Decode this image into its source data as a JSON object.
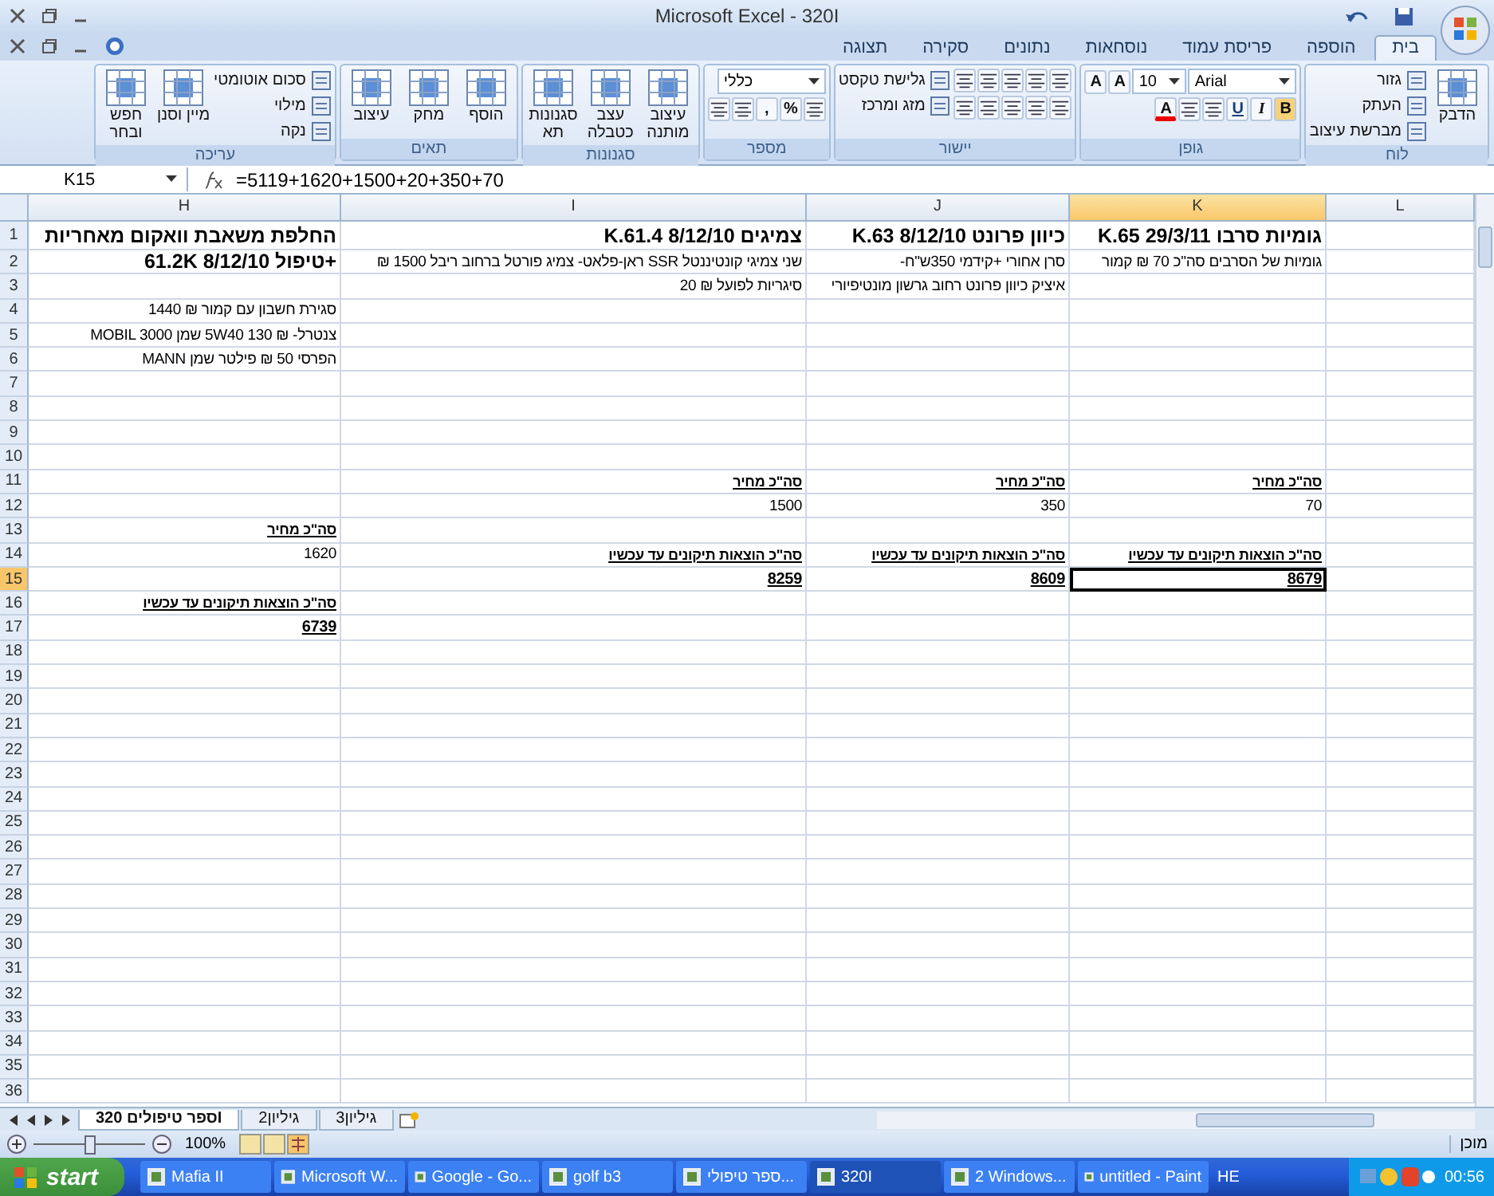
{
  "window": {
    "title": "Microsoft Excel - 320I"
  },
  "ribbon": {
    "tabs": [
      {
        "label": "בית",
        "selected": true
      },
      {
        "label": "הוספה",
        "selected": false
      },
      {
        "label": "פריסת עמוד",
        "selected": false
      },
      {
        "label": "נוסחאות",
        "selected": false
      },
      {
        "label": "נתונים",
        "selected": false
      },
      {
        "label": "סקירה",
        "selected": false
      },
      {
        "label": "תצוגה",
        "selected": false
      }
    ],
    "groups": [
      {
        "label": "לוח",
        "stacks": [
          [
            [
              {
                "kind": "large",
                "label": "הדבק"
              }
            ]
          ],
          [
            [
              {
                "kind": "small",
                "label": "גזור"
              }
            ],
            [
              {
                "kind": "small",
                "label": "העתק"
              }
            ],
            [
              {
                "kind": "small",
                "label": "מברשת עיצוב"
              }
            ]
          ]
        ]
      },
      {
        "label": "גופן",
        "stacks": [
          [
            [
              {
                "kind": "field",
                "value": "Arial"
              },
              {
                "kind": "field",
                "value": "10"
              },
              {
                "kind": "glyph",
                "label": "A"
              },
              {
                "kind": "glyph",
                "label": "A"
              }
            ],
            [
              {
                "kind": "bold",
                "label": "B"
              },
              {
                "kind": "italic",
                "label": "I"
              },
              {
                "kind": "underline",
                "label": "U"
              },
              {
                "kind": "icon"
              },
              {
                "kind": "icon"
              },
              {
                "kind": "colored",
                "label": "A"
              }
            ]
          ]
        ]
      },
      {
        "label": "יישור",
        "stacks": [
          [
            [
              {
                "kind": "icon"
              },
              {
                "kind": "icon"
              },
              {
                "kind": "icon"
              },
              {
                "kind": "icon"
              },
              {
                "kind": "icon"
              }
            ],
            [
              {
                "kind": "icon"
              },
              {
                "kind": "icon"
              },
              {
                "kind": "icon"
              },
              {
                "kind": "icon"
              },
              {
                "kind": "icon"
              }
            ]
          ],
          [
            [
              {
                "kind": "small",
                "label": "גלישת טקסט"
              }
            ],
            [
              {
                "kind": "small",
                "label": "מזג ומרכז"
              }
            ]
          ]
        ]
      },
      {
        "label": "מספר",
        "stacks": [
          [
            [
              {
                "kind": "field",
                "value": "כללי"
              }
            ],
            [
              {
                "kind": "icon"
              },
              {
                "kind": "glyph",
                "label": "%"
              },
              {
                "kind": "glyph",
                "label": ","
              },
              {
                "kind": "icon"
              },
              {
                "kind": "icon"
              }
            ]
          ]
        ]
      },
      {
        "label": "סגנונות",
        "stacks": [
          [
            [
              {
                "kind": "large",
                "label": "עיצוב מותנה"
              }
            ]
          ],
          [
            [
              {
                "kind": "large",
                "label": "עצב כטבלה"
              }
            ]
          ],
          [
            [
              {
                "kind": "large",
                "label": "סגנונות תא"
              }
            ]
          ]
        ]
      },
      {
        "label": "תאים",
        "stacks": [
          [
            [
              {
                "kind": "large",
                "label": "הוסף"
              }
            ]
          ],
          [
            [
              {
                "kind": "large",
                "label": "מחק"
              }
            ]
          ],
          [
            [
              {
                "kind": "large",
                "label": "עיצוב"
              }
            ]
          ]
        ]
      },
      {
        "label": "עריכה",
        "stacks": [
          [
            [
              {
                "kind": "small",
                "label": "סכום אוטומטי"
              }
            ],
            [
              {
                "kind": "small",
                "label": "מילוי"
              }
            ],
            [
              {
                "kind": "small",
                "label": "נקה"
              }
            ]
          ],
          [
            [
              {
                "kind": "large",
                "label": "מיין וסנן"
              }
            ]
          ],
          [
            [
              {
                "kind": "large",
                "label": "חפש ובחר"
              }
            ]
          ]
        ]
      }
    ]
  },
  "formula_bar": {
    "name_box": "K15",
    "formula": "=5119+1620+1500+20+350+70"
  },
  "sheet": {
    "columns": [
      {
        "label": "L",
        "selected": false
      },
      {
        "label": "K",
        "selected": true
      },
      {
        "label": "J",
        "selected": false
      },
      {
        "label": "I",
        "selected": false
      },
      {
        "label": "H",
        "selected": false
      }
    ],
    "rows": [
      {
        "number": "1",
        "selected": false,
        "cells": [
          null,
          {
            "text": "גומיות סרבו K.65 29/3/11",
            "kind": "title",
            "selected": false
          },
          {
            "text": "כיוון פרונט K.63 8/12/10",
            "kind": "title",
            "selected": false
          },
          {
            "text": "צמיגים K.61.4 8/12/10",
            "kind": "title",
            "selected": false
          },
          {
            "text": "החלפת משאבת וואקום מאחריות",
            "kind": "title",
            "selected": false
          }
        ]
      },
      {
        "number": "2",
        "selected": false,
        "cells": [
          null,
          {
            "text": "גומיות של הסרבים סה\"כ 70 ₪ קמור",
            "kind": "text",
            "selected": false
          },
          {
            "text": "סרן אחורי +קידמי 350ש\"ח-",
            "kind": "text",
            "selected": false
          },
          {
            "text": "שני צמיגי קונטיננטל SSR ראן-פלאט- צמיג פורטל ברחוב ריבל 1500 ₪",
            "kind": "text",
            "selected": false
          },
          {
            "text": "+טיפול 61.2K 8/12/10",
            "kind": "title",
            "selected": false
          }
        ]
      },
      {
        "number": "3",
        "selected": false,
        "cells": [
          null,
          null,
          {
            "text": "איציק כיוון פרונט רחוב גרשון מונטיפיורי",
            "kind": "text",
            "selected": false
          },
          {
            "text": "סיגריות לפועל ₪ 20",
            "kind": "text",
            "selected": false
          },
          null
        ]
      },
      {
        "number": "4",
        "selected": false,
        "cells": [
          null,
          null,
          null,
          null,
          {
            "text": "סגירת חשבון עם קמור ₪ 1440",
            "kind": "text",
            "selected": false
          }
        ]
      },
      {
        "number": "5",
        "selected": false,
        "cells": [
          null,
          null,
          null,
          null,
          {
            "text": "צנטרל- ₪ 130 5W40 שמן MOBIL 3000",
            "kind": "text",
            "selected": false
          }
        ]
      },
      {
        "number": "6",
        "selected": false,
        "cells": [
          null,
          null,
          null,
          null,
          {
            "text": "הפרסי 50 ₪ פילטר  שמן MANN",
            "kind": "text",
            "selected": false
          }
        ]
      },
      {
        "number": "7",
        "selected": false
      },
      {
        "number": "8",
        "selected": false
      },
      {
        "number": "9",
        "selected": false
      },
      {
        "number": "10",
        "selected": false
      },
      {
        "number": "11",
        "selected": false,
        "cells": [
          null,
          {
            "text": "סה\"כ מחיר",
            "kind": "label",
            "selected": false
          },
          {
            "text": "סה\"כ מחיר",
            "kind": "label",
            "selected": false
          },
          {
            "text": "סה\"כ מחיר",
            "kind": "label",
            "selected": false
          },
          null
        ]
      },
      {
        "number": "12",
        "selected": false,
        "cells": [
          null,
          {
            "text": "70",
            "kind": "text",
            "selected": false
          },
          {
            "text": "350",
            "kind": "text",
            "selected": false
          },
          {
            "text": "1500",
            "kind": "text",
            "selected": false
          },
          null
        ]
      },
      {
        "number": "13",
        "selected": false,
        "cells": [
          null,
          null,
          null,
          null,
          {
            "text": "סה\"כ מחיר",
            "kind": "label",
            "selected": false
          }
        ]
      },
      {
        "number": "14",
        "selected": false,
        "cells": [
          null,
          {
            "text": "סה\"כ הוצאות תיקונים עד עכשיו",
            "kind": "label",
            "selected": false
          },
          {
            "text": "סה\"כ הוצאות תיקונים עד עכשיו",
            "kind": "label",
            "selected": false
          },
          {
            "text": "סה\"כ הוצאות תיקונים עד עכשיו",
            "kind": "label",
            "selected": false
          },
          {
            "text": "1620",
            "kind": "text",
            "selected": false
          }
        ]
      },
      {
        "number": "15",
        "selected": true,
        "cells": [
          null,
          {
            "text": "8679",
            "kind": "total",
            "selected": true
          },
          {
            "text": "8609",
            "kind": "total",
            "selected": false
          },
          {
            "text": "8259",
            "kind": "total",
            "selected": false
          },
          null
        ]
      },
      {
        "number": "16",
        "selected": false,
        "cells": [
          null,
          null,
          null,
          null,
          {
            "text": "סה\"כ הוצאות תיקונים עד עכשיו",
            "kind": "label",
            "selected": false
          }
        ]
      },
      {
        "number": "17",
        "selected": false,
        "cells": [
          null,
          null,
          null,
          null,
          {
            "text": "6739",
            "kind": "total",
            "selected": false
          }
        ]
      },
      {
        "number": "18",
        "selected": false
      },
      {
        "number": "19",
        "selected": false
      },
      {
        "number": "20",
        "selected": false
      },
      {
        "number": "21",
        "selected": false
      },
      {
        "number": "22",
        "selected": false
      },
      {
        "number": "23",
        "selected": false
      },
      {
        "number": "24",
        "selected": false
      },
      {
        "number": "25",
        "selected": false
      },
      {
        "number": "26",
        "selected": false
      },
      {
        "number": "27",
        "selected": false
      },
      {
        "number": "28",
        "selected": false
      },
      {
        "number": "29",
        "selected": false
      },
      {
        "number": "30",
        "selected": false
      },
      {
        "number": "31",
        "selected": false
      },
      {
        "number": "32",
        "selected": false
      },
      {
        "number": "33",
        "selected": false
      },
      {
        "number": "34",
        "selected": false
      },
      {
        "number": "35",
        "selected": false
      },
      {
        "number": "36",
        "selected": false
      }
    ]
  },
  "sheet_tabs": [
    {
      "label": "גיליון3",
      "selected": false
    },
    {
      "label": "גיליון2",
      "selected": false
    },
    {
      "label": "ספר טיפולים 320I",
      "selected": true
    }
  ],
  "status_bar": {
    "zoom": "100%",
    "status": "מוכן",
    "zoom_slider": {
      "level": 0.5
    }
  },
  "taskbar": {
    "start": "start",
    "items": [
      {
        "label": "untitled - Paint",
        "selected": false
      },
      {
        "label": "2 Windows...",
        "selected": false
      },
      {
        "label": "320I",
        "selected": true
      },
      {
        "label": "ספר טיפולי...",
        "selected": false
      },
      {
        "label": "golf b3",
        "selected": false
      },
      {
        "label": "Google - Go...",
        "selected": false
      },
      {
        "label": "Microsoft W...",
        "selected": false
      },
      {
        "label": "Mafia II",
        "selected": false
      }
    ],
    "language": "HE",
    "clock": "00:56"
  }
}
